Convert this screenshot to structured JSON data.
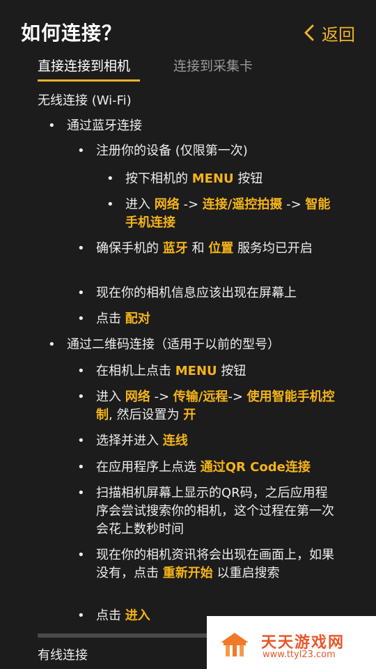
{
  "header": {
    "title": "如何连接？",
    "back_label": "返回",
    "accent_color": "#f0b429"
  },
  "tabs": [
    {
      "label": "直接连接到相机",
      "active": true
    },
    {
      "label": "连接到采集卡",
      "active": false
    }
  ],
  "content": {
    "section_wifi": "无线连接 (Wi-Fi)",
    "bt": {
      "title": "通过蓝牙连接",
      "register": "注册你的设备 (仅限第一次)",
      "press_pre": "按下相机的",
      "press_menu": "MENU",
      "press_post": "按钮",
      "enter_pre": "进入",
      "enter_net": "网络",
      "enter_arrow1": "->",
      "enter_remote": "连接/遥控拍摄",
      "enter_arrow2": "->",
      "enter_phone": "智能手机连接",
      "ensure_pre": "确保手机的",
      "ensure_bt": "蓝牙",
      "ensure_and": "和",
      "ensure_loc": "位置",
      "ensure_post": "服务均已开启",
      "info_appear": "现在你的相机信息应该出现在屏幕上",
      "click_pre": "点击",
      "click_pair": "配对"
    },
    "qr": {
      "title": "通过二维码连接（适用于以前的型号）",
      "press_pre": "在相机上点击",
      "press_menu": "MENU",
      "press_post": "按钮",
      "enter_pre": "进入",
      "enter_net": "网络",
      "enter_arrow1": "->",
      "enter_transfer": "传输/远程",
      "enter_arrow2": "->",
      "enter_phone_ctrl": "使用智能手机控制",
      "enter_then": ", 然后设置为",
      "enter_on": "开",
      "select_pre": "选择并进入",
      "select_link": "连线",
      "app_pre": "在应用程序上点选",
      "app_qr": "通过QR Code连接",
      "scan_text": "扫描相机屏幕上显示的QR码，之后应用程序会尝试搜索你的相机，这个过程在第一次会花上数秒时间",
      "info_pre": "现在你的相机资讯将会出现在画面上，如果没有，点击",
      "info_restart": "重新开始",
      "info_post": "以重启搜索",
      "click_pre": "点击",
      "click_enter": "进入"
    },
    "section_wired": "有线连接"
  },
  "watermark": {
    "title": "天天游戏网",
    "url": "www.ttyl23.com"
  }
}
